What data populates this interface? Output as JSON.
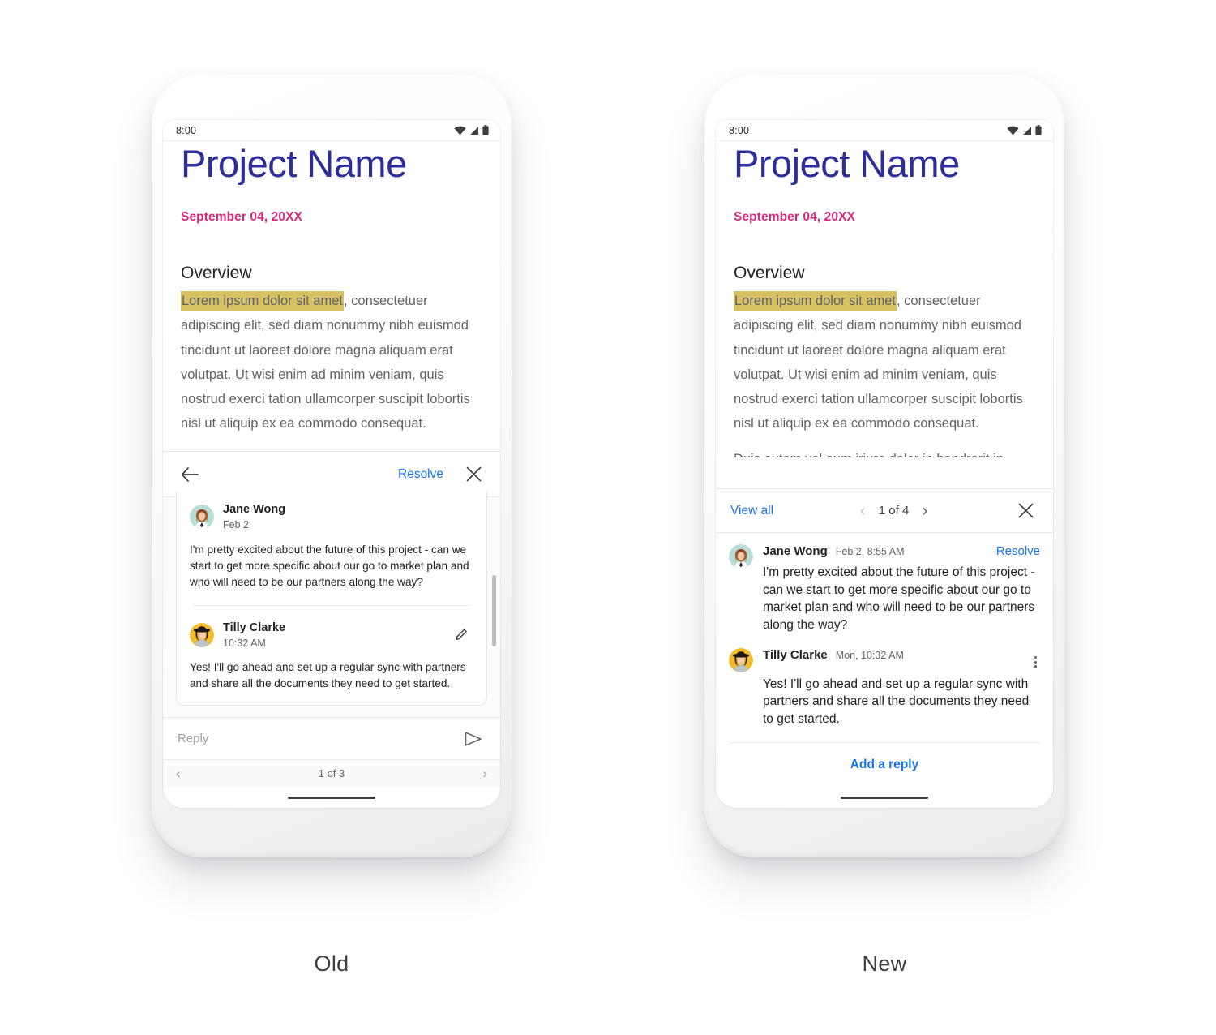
{
  "status_bar": {
    "time": "8:00",
    "icons": [
      "wifi-icon",
      "signal-icon",
      "battery-icon"
    ]
  },
  "document": {
    "title": "Project Name",
    "date": "September 04, 20XX",
    "heading": "Overview",
    "highlighted_text": "Lorem ipsum dolor sit amet",
    "body_rest": ", consectetuer adipiscing elit, sed diam nonummy nibh euismod tincidunt ut laoreet dolore magna aliquam erat volutpat. Ut wisi enim ad minim veniam, quis nostrud exerci tation ullamcorper suscipit lobortis nisl ut aliquip ex ea commodo consequat.",
    "next_paragraph_clipped": "Duis autem vel eum iriure dolor in hendrerit in vulputate"
  },
  "old": {
    "caption": "Old",
    "header": {
      "back_icon": "back-arrow-icon",
      "resolve_label": "Resolve",
      "close_icon": "close-icon"
    },
    "comments": [
      {
        "author": "Jane Wong",
        "timestamp": "Feb 2",
        "text": "I'm pretty excited about the future of this project - can we start to get more specific about our go to market plan and who will need to be our partners along the way?",
        "avatar": "jane-wong-avatar"
      },
      {
        "author": "Tilly Clarke",
        "timestamp": "10:32 AM",
        "text": "Yes! I'll go ahead and set up a regular sync with partners and share all the documents they need to get started.",
        "avatar": "tilly-clarke-avatar",
        "action_icon": "pencil-icon"
      }
    ],
    "reply": {
      "placeholder": "Reply",
      "send_icon": "send-icon"
    },
    "pager": {
      "prev": "‹",
      "label": "1 of 3",
      "next": "›"
    }
  },
  "new": {
    "caption": "New",
    "header": {
      "view_all_label": "View all",
      "prev": "‹",
      "pager_label": "1 of 4",
      "next": "›",
      "close_icon": "close-icon"
    },
    "comments": [
      {
        "author": "Jane Wong",
        "timestamp": "Feb 2, 8:55 AM",
        "text": "I'm pretty excited about the future of this project - can we start to get more specific about our go to market plan and who will need to be our partners along the way?",
        "avatar": "jane-wong-avatar",
        "action_label": "Resolve"
      },
      {
        "author": "Tilly Clarke",
        "timestamp": "Mon, 10:32 AM",
        "text": "Yes! I'll go ahead and set up a regular sync with partners and share all the documents they need to get started.",
        "avatar": "tilly-clarke-avatar",
        "action_icon": "more-vert-icon"
      }
    ],
    "add_reply_label": "Add a reply"
  },
  "colors": {
    "title_blue": "#2c2f9b",
    "date_pink": "#d6297b",
    "highlight_gold": "#d8c163",
    "link_blue": "#1a73e8",
    "body_gray": "#5f6368"
  }
}
